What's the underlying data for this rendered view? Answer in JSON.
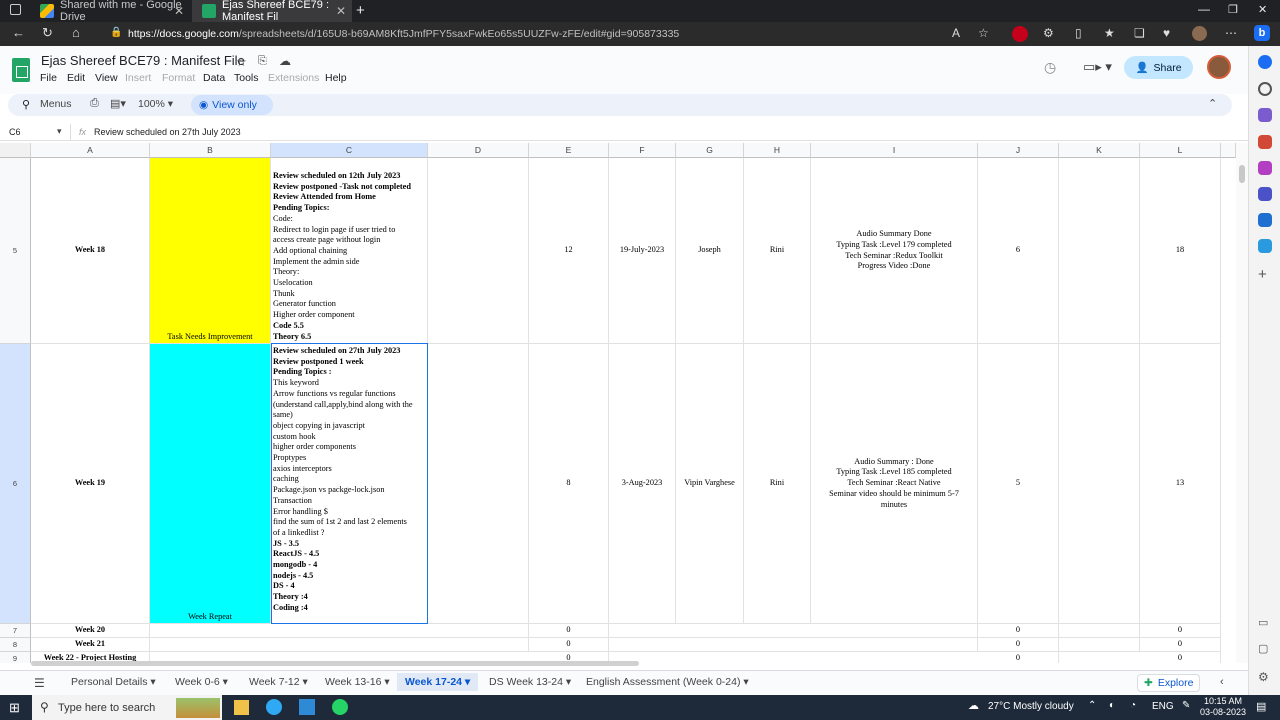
{
  "browser": {
    "tabs": [
      {
        "label": "Shared with me - Google Drive"
      },
      {
        "label": "Ejas Shereef BCE79 : Manifest Fil"
      }
    ],
    "url_host": "https://docs.google.com",
    "url_path": "/spreadsheets/d/165U8-b69AM8Kft5JmfPFY5saxFwkEo65s5UUZFw-zFE/edit#gid=905873335"
  },
  "doc": {
    "title": "Ejas Shereef BCE79 : Manifest File",
    "share": "Share",
    "menus": [
      "File",
      "Edit",
      "View",
      "Insert",
      "Format",
      "Data",
      "Tools",
      "Extensions",
      "Help"
    ]
  },
  "toolbar": {
    "search": "Menus",
    "zoom": "100%",
    "view_only": "View only"
  },
  "formula": {
    "cell_ref": "C6",
    "fx": "fx",
    "content": "Review scheduled on 27th July 2023"
  },
  "columns": [
    "A",
    "B",
    "C",
    "D",
    "E",
    "F",
    "G",
    "H",
    "I",
    "J",
    "K",
    "L"
  ],
  "rows": {
    "r5": {
      "num": "5",
      "a": "Week 18",
      "b": "Task Needs Improvement",
      "c": [
        {
          "t": "Review scheduled on 12th July 2023",
          "b": true
        },
        {
          "t": "Review postponed -Task not completed",
          "b": true
        },
        {
          "t": "Review Attended from Home",
          "b": true
        },
        {
          "t": "Pending Topics:",
          "b": true
        },
        {
          "t": "Code:"
        },
        {
          "t": "Redirect to login page if user tried to"
        },
        {
          "t": "access create page without login"
        },
        {
          "t": "Add optional chaining"
        },
        {
          "t": "Implement the admin side"
        },
        {
          "t": "Theory:"
        },
        {
          "t": "Uselocation"
        },
        {
          "t": "Thunk"
        },
        {
          "t": "Generator function"
        },
        {
          "t": "Higher order component"
        },
        {
          "t": "Code 5.5",
          "b": true
        },
        {
          "t": "Theory 6.5",
          "b": true
        }
      ],
      "e": "12",
      "f": "19-July-2023",
      "g": "Joseph",
      "h": "Rini",
      "i": [
        "Audio Summary Done",
        "Typing Task :Level 179 completed",
        "Tech Seminar :Redux Toolkit",
        "Progress Video :Done"
      ],
      "j": "6",
      "l": "18"
    },
    "r6": {
      "num": "6",
      "a": "Week 19",
      "b": "Week Repeat",
      "c": [
        {
          "t": "Review scheduled on 27th July 2023",
          "b": true
        },
        {
          "t": "Review postponed 1 week",
          "b": true
        },
        {
          "t": "Pending Topics :",
          "b": true
        },
        {
          "t": "This keyword"
        },
        {
          "t": "Arrow functions vs regular functions"
        },
        {
          "t": "(understand call,apply,bind along with the"
        },
        {
          "t": "same)"
        },
        {
          "t": "object copying in javascript"
        },
        {
          "t": "custom hook"
        },
        {
          "t": "higher order components"
        },
        {
          "t": "Proptypes"
        },
        {
          "t": "axios interceptors"
        },
        {
          "t": "caching"
        },
        {
          "t": "Package.json vs packge-lock.json"
        },
        {
          "t": "Transaction"
        },
        {
          "t": "Error handling $"
        },
        {
          "t": "find the sum of 1st 2 and last 2 elements"
        },
        {
          "t": "of a linkedlist ?"
        },
        {
          "t": "JS - 3.5",
          "b": true
        },
        {
          "t": "ReactJS - 4.5",
          "b": true
        },
        {
          "t": "mongodb - 4",
          "b": true
        },
        {
          "t": "nodejs - 4.5",
          "b": true
        },
        {
          "t": "DS - 4",
          "b": true
        },
        {
          "t": " "
        },
        {
          "t": "Theory :4",
          "b": true
        },
        {
          "t": "Coding :4",
          "b": true
        }
      ],
      "e": "8",
      "f": "3-Aug-2023",
      "g": "Vipin Varghese",
      "h": "Rini",
      "i": [
        "Audio Summary : Done",
        "Typing Task :Level 185 completed",
        "Tech Seminar :React Native",
        "Seminar video should be minimum 5-7",
        "minutes"
      ],
      "j": "5",
      "l": "13"
    },
    "r7": {
      "num": "7",
      "a": "Week 20",
      "e": "0",
      "j": "0",
      "l": "0"
    },
    "r8": {
      "num": "8",
      "a": "Week 21",
      "e": "0",
      "j": "0",
      "l": "0"
    },
    "r9": {
      "num": "9",
      "a": "Week 22 - Project Hosting",
      "e": "0",
      "j": "0",
      "l": "0"
    }
  },
  "sheet_tabs": [
    "Personal Details",
    "Week 0-6",
    "Week 7-12",
    "Week 13-16",
    "Week 17-24",
    "DS Week 13-24",
    "English Assessment (Week 0-24)"
  ],
  "explore": "Explore",
  "taskbar": {
    "search": "Type here to search",
    "weather": "27°C  Mostly cloudy",
    "lang": "ENG",
    "time": "10:15 AM",
    "date": "03-08-2023"
  },
  "colors": {
    "yellow": "#ffff00",
    "cyan": "#00ffff",
    "accent": "#0b57d0"
  }
}
